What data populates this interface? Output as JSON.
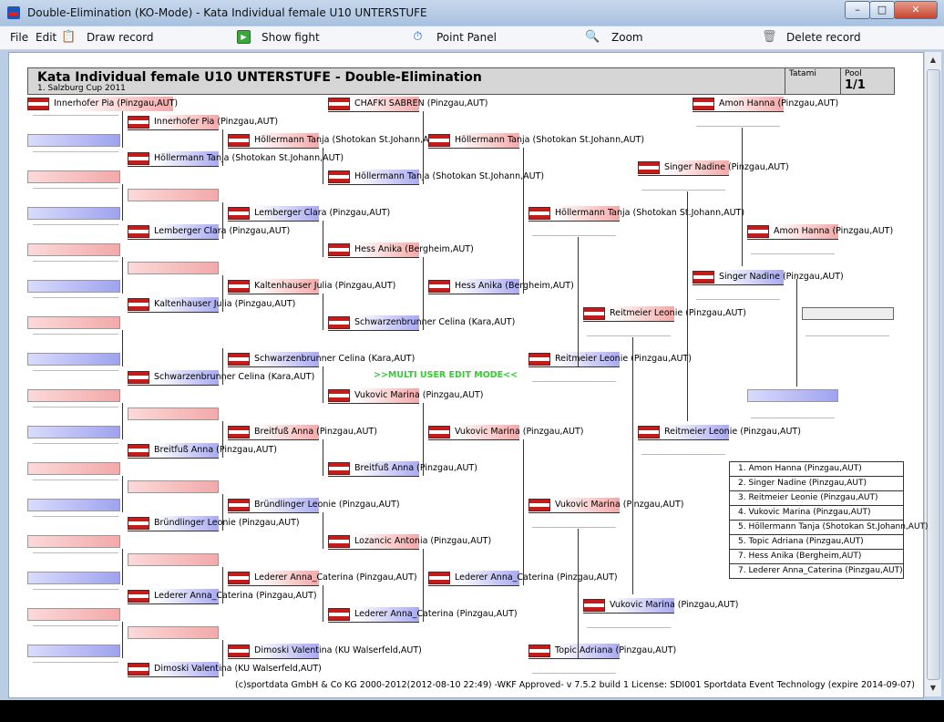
{
  "window": {
    "title": "Double-Elimination (KO-Mode) - Kata Individual female U10 UNTERSTUFE",
    "min_label": "–",
    "max_label": "□",
    "close_label": "✕"
  },
  "menu": {
    "file": "File",
    "edit": "Edit",
    "draw_record": "Draw record",
    "show_fight": "Show fight",
    "point_panel": "Point Panel",
    "zoom": "Zoom",
    "delete_record": "Delete record"
  },
  "icons": {
    "draw_record": "clipboard-icon",
    "show_fight": "play-icon",
    "point_panel": "stopwatch-icon",
    "zoom": "magnifier-icon",
    "delete_record": "trash-icon"
  },
  "header": {
    "title": "Kata Individual female U10 UNTERSTUFE - Double-Elimination",
    "subtitle": "1. Salzburg Cup 2011",
    "tatami_label": "Tatami",
    "tatami_value": "",
    "pool_label": "Pool",
    "pool_value": "1/1"
  },
  "round1": [
    "Innerhofer Pia (Pinzgau,AUT)",
    "Höllermann Tanja (Shotokan St.Johann,AUT)",
    "Lemberger Clara (Pinzgau,AUT)",
    "Kaltenhauser Julia (Pinzgau,AUT)",
    "Schwarzenbrunner Celina (Kara,AUT)",
    "Breitfuß Anna (Pinzgau,AUT)",
    "Bründlinger Leonie (Pinzgau,AUT)",
    "Lederer Anna_Caterina (Pinzgau,AUT)",
    "Dimoski Valentina (KU Walserfeld,AUT)"
  ],
  "round2": [
    "Innerhofer Pia (Pinzgau,AUT)",
    "Höllermann Tanja (Shotokan St.Johann,AUT)",
    "Lemberger Clara (Pinzgau,AUT)",
    "Kaltenhauser Julia (Pinzgau,AUT)",
    "Schwarzenbrunner Celina (Kara,AUT)",
    "Breitfuß Anna (Pinzgau,AUT)",
    "Bründlinger Leonie (Pinzgau,AUT)",
    "Lederer Anna_Caterina (Pinzgau,AUT)",
    "Dimoski Valentina (KU Walserfeld,AUT)"
  ],
  "round3": [
    "CHAFKI SABREN (Pinzgau,AUT)",
    "Höllermann Tanja (Shotokan St.Johann,AUT)",
    "Hess Anika (Bergheim,AUT)",
    "Schwarzenbrunner Celina (Kara,AUT)",
    "Vukovic Marina (Pinzgau,AUT)",
    "Breitfuß Anna (Pinzgau,AUT)",
    "Lozancic Antonia (Pinzgau,AUT)",
    "Lederer Anna_Caterina (Pinzgau,AUT)"
  ],
  "round4": [
    "Höllermann Tanja (Shotokan St.Johann,AUT)",
    "Hess Anika (Bergheim,AUT)",
    "Vukovic Marina (Pinzgau,AUT)",
    "Lederer Anna_Caterina (Pinzgau,AUT)"
  ],
  "round5": [
    "Höllermann Tanja (Shotokan St.Johann,AUT)",
    "Reitmeier Leonie (Pinzgau,AUT)",
    "Vukovic Marina (Pinzgau,AUT)",
    "Topic Adriana (Pinzgau,AUT)"
  ],
  "round6": [
    "Reitmeier Leonie (Pinzgau,AUT)",
    "Vukovic Marina (Pinzgau,AUT)"
  ],
  "round7": [
    "Singer Nadine (Pinzgau,AUT)",
    "Reitmeier Leonie (Pinzgau,AUT)"
  ],
  "round8": [
    "Amon Hanna (Pinzgau,AUT)",
    "Singer Nadine (Pinzgau,AUT)",
    "Amon Hanna (Pinzgau,AUT)"
  ],
  "banner": ">>MULTI USER EDIT MODE<<",
  "results": [
    "1. Amon Hanna (Pinzgau,AUT)",
    "2. Singer Nadine (Pinzgau,AUT)",
    "3. Reitmeier Leonie (Pinzgau,AUT)",
    "4. Vukovic Marina (Pinzgau,AUT)",
    "5. Höllermann Tanja (Shotokan St.Johann,AUT)",
    "5. Topic Adriana (Pinzgau,AUT)",
    "7. Hess Anika (Bergheim,AUT)",
    "7. Lederer Anna_Caterina (Pinzgau,AUT)"
  ],
  "footer": "(c)sportdata GmbH & Co KG 2000-2012(2012-08-10 22:49) -WKF Approved- v 7.5.2 build 1 License: SDI001 Sportdata Event Technology (expire 2014-09-07)"
}
